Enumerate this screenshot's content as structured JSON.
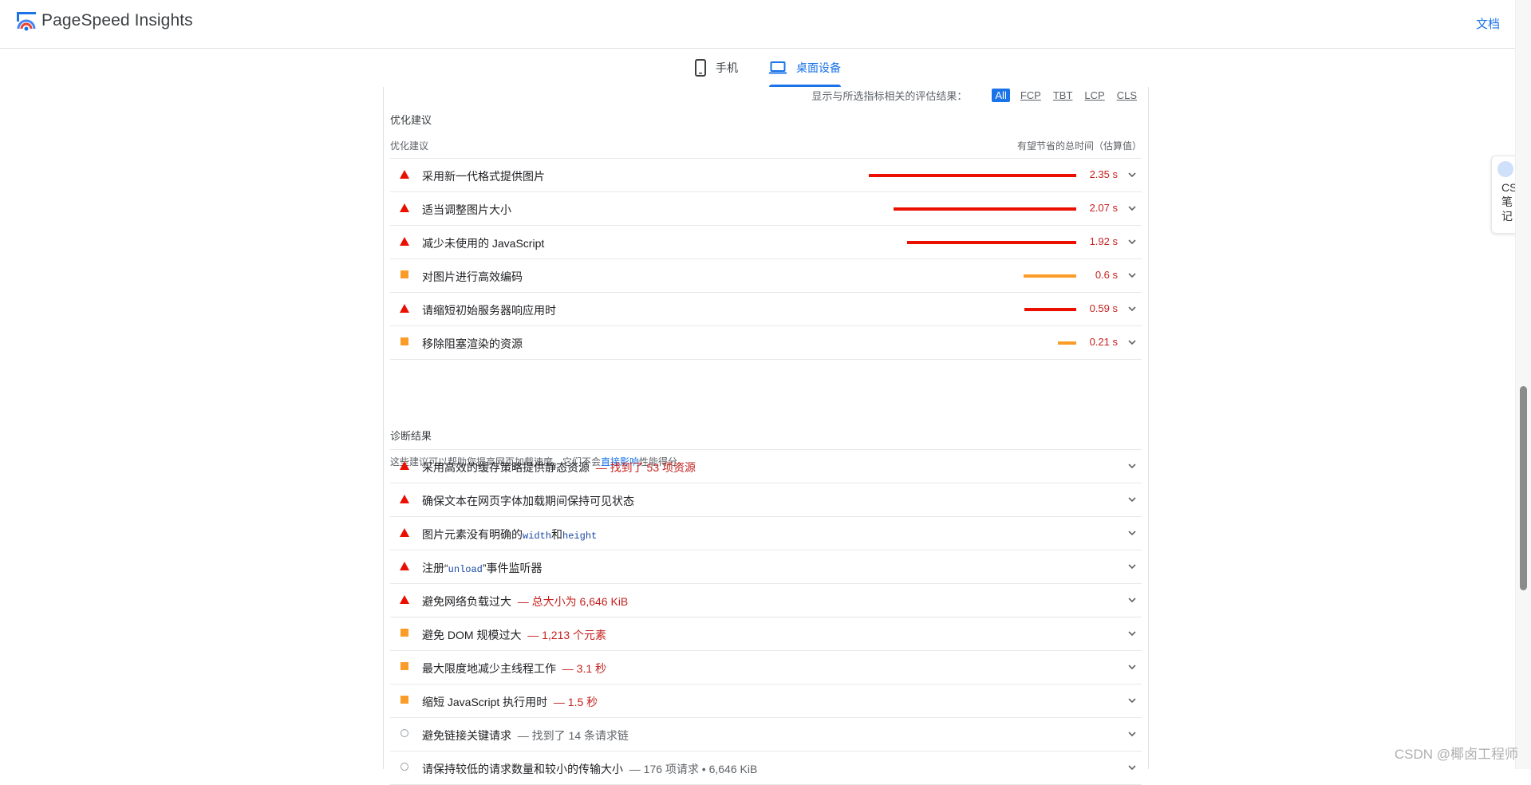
{
  "header": {
    "brand": "PageSpeed Insights",
    "docs_link": "文档"
  },
  "device_tabs": [
    {
      "label": "手机",
      "icon": "phone-icon",
      "active": false
    },
    {
      "label": "桌面设备",
      "icon": "laptop-icon",
      "active": true
    }
  ],
  "filter": {
    "label": "显示与所选指标相关的评估结果：",
    "options": [
      "All",
      "FCP",
      "TBT",
      "LCP",
      "CLS"
    ],
    "selected": "All"
  },
  "opportunities": {
    "section_title": "优化建议",
    "col_left": "优化建议",
    "col_right": "有望节省的总时间（估算值）",
    "items": [
      {
        "label": "采用新一代格式提供图片",
        "value": "2.35 s",
        "savings_seconds": 2.35,
        "severity": "fail",
        "icon": "red-triangle-icon"
      },
      {
        "label": "适当调整图片大小",
        "value": "2.07 s",
        "savings_seconds": 2.07,
        "severity": "fail",
        "icon": "red-triangle-icon"
      },
      {
        "label": "减少未使用的 JavaScript",
        "value": "1.92 s",
        "savings_seconds": 1.92,
        "severity": "fail",
        "icon": "red-triangle-icon"
      },
      {
        "label": "对图片进行高效编码",
        "value": "0.6 s",
        "savings_seconds": 0.6,
        "severity": "average",
        "icon": "orange-square-icon"
      },
      {
        "label": "请缩短初始服务器响应用时",
        "value": "0.59 s",
        "savings_seconds": 0.59,
        "severity": "fail",
        "icon": "red-triangle-icon"
      },
      {
        "label": "移除阻塞渲染的资源",
        "value": "0.21 s",
        "savings_seconds": 0.21,
        "severity": "average",
        "icon": "orange-square-icon"
      }
    ],
    "note_prefix": "这些建议可以帮助您提高网页加载速度。它们不会",
    "note_link": "直接影响",
    "note_suffix": "性能得分。"
  },
  "diagnostics": {
    "section_title": "诊断结果",
    "items": [
      {
        "label": "采用高效的缓存策略提供静态资源",
        "detail": "— 找到了 53 项资源",
        "severity": "fail",
        "icon": "red-triangle-icon"
      },
      {
        "label": "确保文本在网页字体加载期间保持可见状态",
        "severity": "fail",
        "icon": "red-triangle-icon"
      },
      {
        "label_parts": [
          "图片元素没有明确的",
          "width",
          "和",
          "height"
        ],
        "severity": "fail",
        "icon": "red-triangle-icon"
      },
      {
        "label_parts": [
          "注册“",
          "unload",
          "”事件监听器"
        ],
        "severity": "fail",
        "icon": "red-triangle-icon"
      },
      {
        "label": "避免网络负载过大",
        "detail": "— 总大小为 6,646 KiB",
        "severity": "fail",
        "icon": "red-triangle-icon"
      },
      {
        "label": "避免 DOM 规模过大",
        "detail": "— 1,213 个元素",
        "severity": "average",
        "icon": "orange-square-icon"
      },
      {
        "label": "最大限度地减少主线程工作",
        "detail": "— 3.1 秒",
        "severity": "average",
        "icon": "orange-square-icon"
      },
      {
        "label": "缩短 JavaScript 执行用时",
        "detail": "— 1.5 秒",
        "severity": "average",
        "icon": "orange-square-icon"
      },
      {
        "label": "避免链接关键请求",
        "detail": "— 找到了 14 条请求链",
        "severity": "info",
        "icon": "grey-circle-icon"
      },
      {
        "label": "请保持较低的请求数量和较小的传输大小",
        "detail": "— 176 项请求 • 6,646 KiB",
        "severity": "info",
        "icon": "grey-circle-icon"
      }
    ]
  },
  "side_widget": {
    "text": "CSDN笔记"
  },
  "watermark": "CSDN @椰卤工程师",
  "colors": {
    "fail": "#eb0f00",
    "average": "#fa9c27",
    "info": "#9aa0a6",
    "accent": "#1a73e8",
    "fail_text": "#c5221f"
  }
}
